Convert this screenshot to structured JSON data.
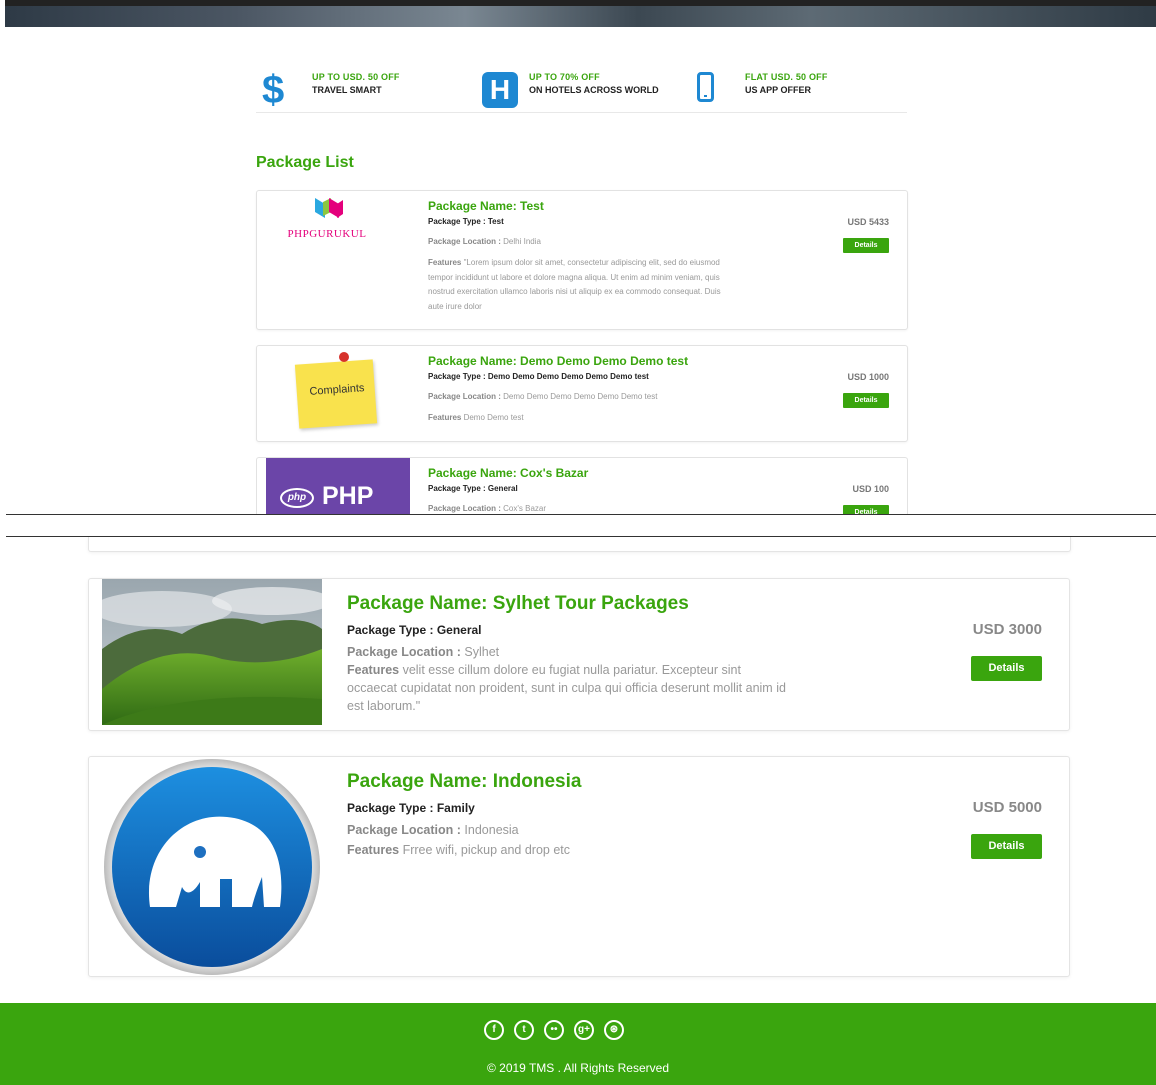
{
  "offers": [
    {
      "line1": "UP TO USD. 50 OFF",
      "line2": "TRAVEL SMART",
      "icon": "dollar-icon"
    },
    {
      "line1": "UP TO 70% OFF",
      "line2": "ON HOTELS ACROSS WORLD",
      "icon": "hotel-icon"
    },
    {
      "line1": "FLAT USD. 50 OFF",
      "line2": "US APP OFFER",
      "icon": "mobile-icon"
    }
  ],
  "section_title": "Package List",
  "packages_top": [
    {
      "name": "Package Name: Test",
      "type": "Package Type : Test",
      "location_label": "Package Location :",
      "location": " Delhi India",
      "features_label": "Features",
      "features": " \"Lorem ipsum dolor sit amet, consectetur adipiscing elit, sed do eiusmod tempor incididunt ut labore et dolore magna aliqua. Ut enim ad minim veniam, quis nostrud exercitation ullamco laboris nisi ut aliquip ex ea commodo consequat. Duis aute irure dolor",
      "price": "USD 5433",
      "button": "Details",
      "image_text": "PHPGURUKUL"
    },
    {
      "name": "Package Name: Demo Demo Demo Demo test",
      "type": "Package Type : Demo Demo Demo Demo Demo Demo test",
      "location_label": "Package Location :",
      "location": " Demo Demo Demo Demo Demo Demo test",
      "features_label": "Features",
      "features": " Demo Demo test",
      "price": "USD 1000",
      "button": "Details",
      "image_text": "Complaints"
    },
    {
      "name": "Package Name: Cox's Bazar",
      "type": "Package Type : General",
      "location_label": "Package Location :",
      "location": " Cox's Bazar",
      "price": "USD 100",
      "button": "Details",
      "image_text": "PHP",
      "image_badge": "php"
    }
  ],
  "packages_bottom": [
    {
      "name": "Package Name: Sylhet Tour Packages",
      "type": "Package Type : General",
      "location_label": "Package Location :",
      "location": " Sylhet",
      "features_label": "Features",
      "features": " velit esse cillum dolore eu fugiat nulla pariatur. Excepteur sint occaecat cupidatat non proident, sunt in culpa qui officia deserunt mollit anim id est laborum.\"",
      "price": "USD 3000",
      "button": "Details"
    },
    {
      "name": "Package Name: Indonesia",
      "type": "Package Type : Family",
      "location_label": "Package Location :",
      "location": " Indonesia",
      "features_label": "Features",
      "features": " Frree wifi, pickup and drop etc",
      "price": "USD 5000",
      "button": "Details"
    }
  ],
  "footer": {
    "social_icons": [
      "facebook-icon",
      "twitter-icon",
      "flickr-icon",
      "google-plus-icon",
      "dribbble-icon"
    ],
    "social_glyphs": [
      "f",
      "t",
      "••",
      "g+",
      "⊛"
    ],
    "copyright": "© 2019 TMS . All Rights Reserved"
  },
  "colors": {
    "accent": "#3aa50e",
    "icon_blue": "#1e88d2"
  }
}
